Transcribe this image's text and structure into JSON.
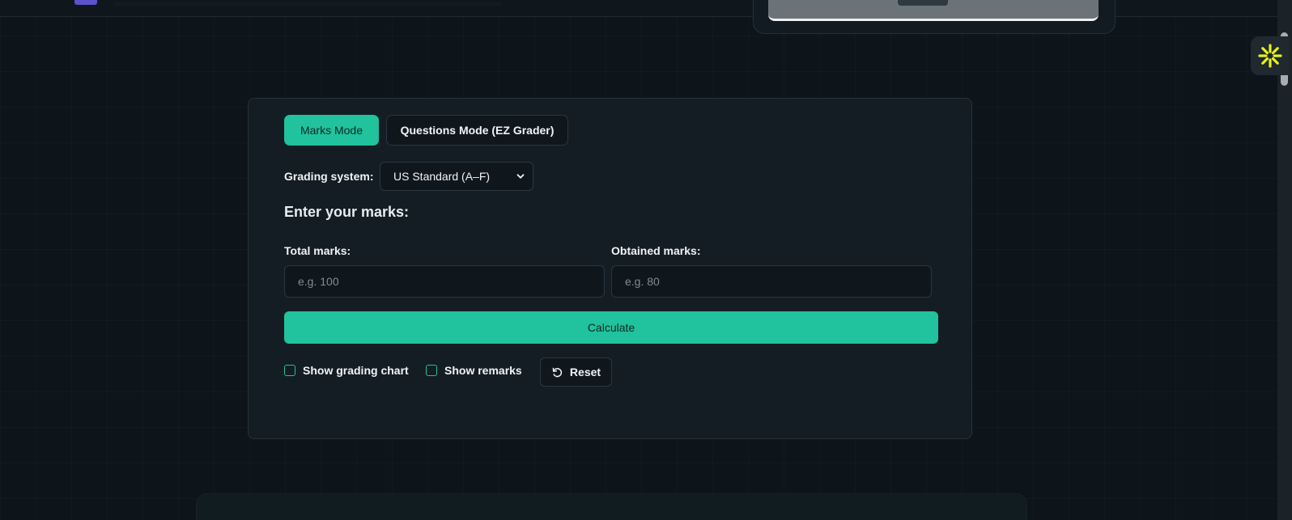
{
  "modes": {
    "marks_label": "Marks Mode",
    "questions_label": "Questions Mode (EZ Grader)"
  },
  "grading": {
    "label": "Grading system:",
    "selected": "US Standard (A–F)"
  },
  "marks": {
    "section_title": "Enter your marks:",
    "total_label": "Total marks:",
    "total_placeholder": "e.g. 100",
    "total_value": "",
    "obtained_label": "Obtained marks:",
    "obtained_placeholder": "e.g. 80",
    "obtained_value": ""
  },
  "actions": {
    "calculate_label": "Calculate",
    "show_chart_label": "Show grading chart",
    "show_remarks_label": "Show remarks",
    "reset_label": "Reset"
  },
  "colors": {
    "accent": "#21c29e",
    "background": "#0d141a",
    "card": "#141d23",
    "widget_icon": "#e8f01e"
  },
  "icons": {
    "side_widget": "asterisk-burst-icon",
    "reset": "reset-icon",
    "select": "chevron-down-icon"
  }
}
